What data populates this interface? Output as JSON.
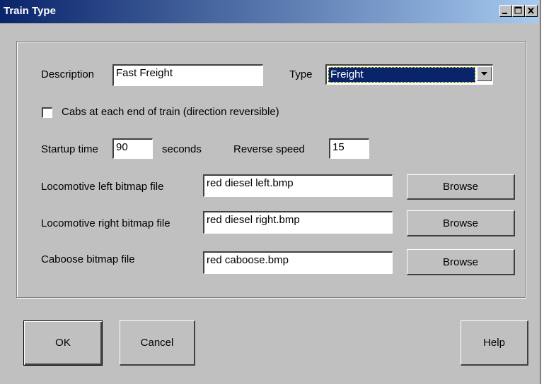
{
  "window": {
    "title": "Train Type"
  },
  "form": {
    "description_label": "Description",
    "description_value": "Fast Freight",
    "type_label": "Type",
    "type_value": "Freight",
    "cabs_label": "Cabs at each end of train (direction reversible)",
    "cabs_checked": false,
    "startup_label": "Startup time",
    "startup_value": "90",
    "seconds_label": "seconds",
    "reverse_label": "Reverse speed",
    "reverse_value": "15",
    "loco_left_label": "Locomotive left bitmap file",
    "loco_left_value": "red diesel left.bmp",
    "loco_right_label": "Locomotive right bitmap file",
    "loco_right_value": "red diesel right.bmp",
    "caboose_label": "Caboose bitmap file",
    "caboose_value": "red caboose.bmp",
    "browse_label": "Browse"
  },
  "buttons": {
    "ok": "OK",
    "cancel": "Cancel",
    "help": "Help"
  },
  "icons": {
    "minimize": "minimize-icon",
    "maximize": "maximize-icon",
    "close": "close-icon",
    "dropdown": "chevron-down-icon"
  }
}
